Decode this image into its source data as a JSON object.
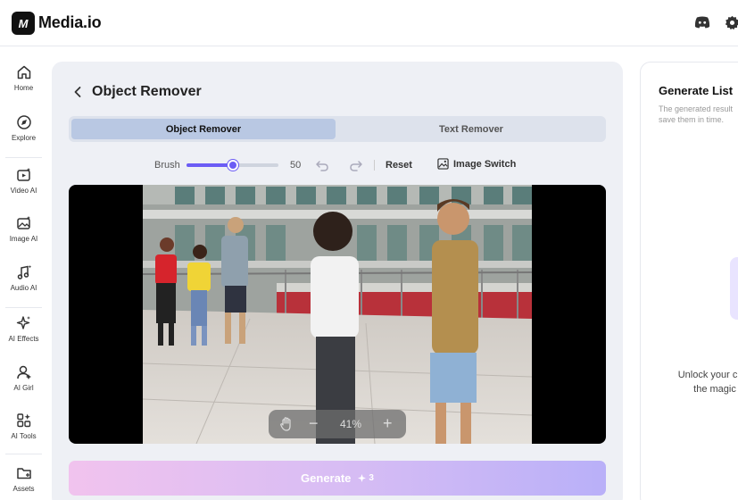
{
  "app": {
    "logo_mark": "M",
    "name": "Media.io"
  },
  "header": {
    "icons": [
      "discord-icon",
      "gear-icon"
    ]
  },
  "sidebar": {
    "items": [
      {
        "label": "Home",
        "icon": "home-icon"
      },
      {
        "label": "Explore",
        "icon": "compass-icon"
      },
      {
        "label": "Video AI",
        "icon": "video-ai-icon"
      },
      {
        "label": "Image AI",
        "icon": "image-ai-icon"
      },
      {
        "label": "Audio AI",
        "icon": "audio-ai-icon"
      },
      {
        "label": "AI Effects",
        "icon": "sparkle-icon"
      },
      {
        "label": "AI Girl",
        "icon": "ai-girl-icon"
      },
      {
        "label": "AI Tools",
        "icon": "tools-grid-icon"
      },
      {
        "label": "Assets",
        "icon": "folder-icon"
      }
    ]
  },
  "main": {
    "title": "Object Remover",
    "tabs": [
      {
        "label": "Object Remover",
        "active": true
      },
      {
        "label": "Text Remover",
        "active": false
      }
    ],
    "toolbar": {
      "brush_label": "Brush",
      "brush_value": "50",
      "brush_level_percent": 50,
      "reset_label": "Reset",
      "switch_label": "Image Switch"
    },
    "zoom": {
      "value": "41%",
      "minus": "−",
      "plus": "+"
    },
    "generate": {
      "label": "Generate",
      "cost": "3"
    }
  },
  "right_panel": {
    "title": "Generate List",
    "description_line1": "The generated result",
    "description_line2": "save them in time.",
    "unlock_line1": "Unlock your crea",
    "unlock_line2": "the magic"
  },
  "colors": {
    "accent": "#6b5cf5",
    "tab_active": "#b9c8e3",
    "panel_bg": "#eef0f5"
  }
}
